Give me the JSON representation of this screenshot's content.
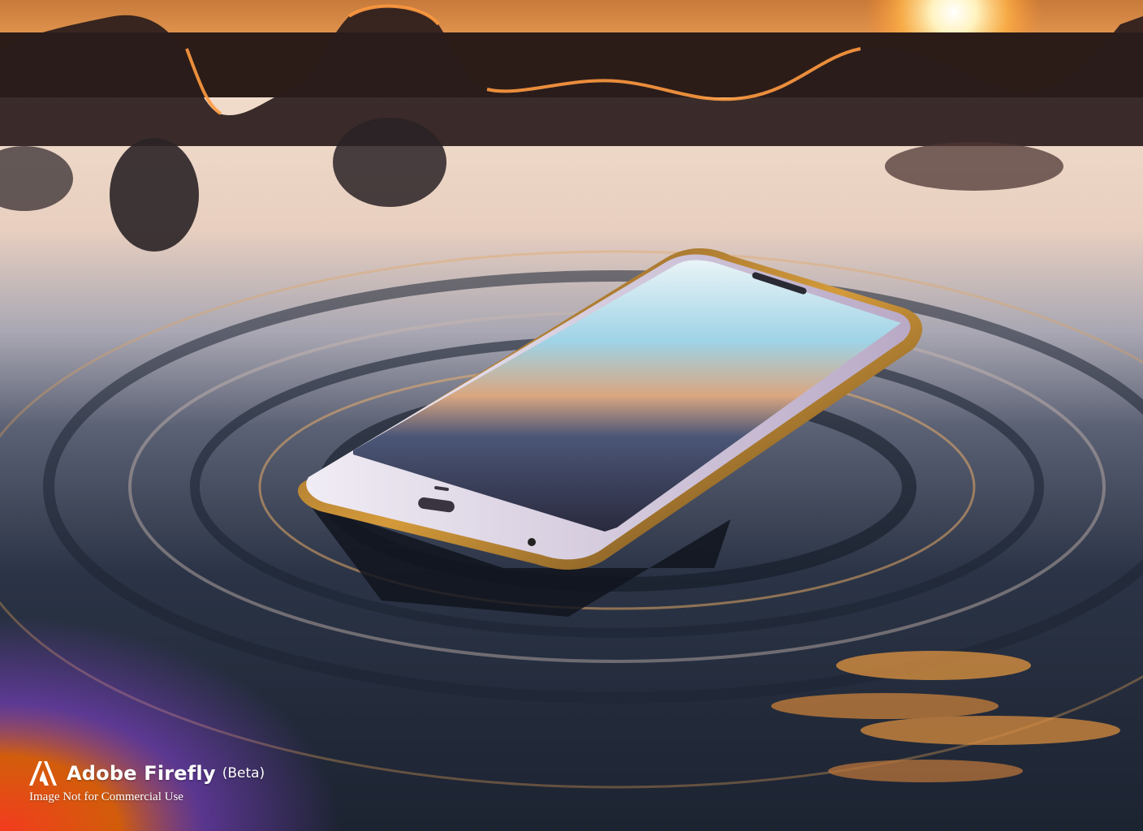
{
  "watermark": {
    "brand": "Adobe Firefly",
    "badge": "(Beta)",
    "note": "Image Not for Commercial Use",
    "logo_icon": "adobe-logo-icon"
  },
  "colors": {
    "sunset_orange": "#f59a3a",
    "water_dark": "#1e2636",
    "water_light": "#e9d6c6",
    "phone_frame": "#d9d4dc",
    "watermark_gradient": [
      "#ff3b1f",
      "#ff7a00",
      "#a24bff"
    ]
  }
}
